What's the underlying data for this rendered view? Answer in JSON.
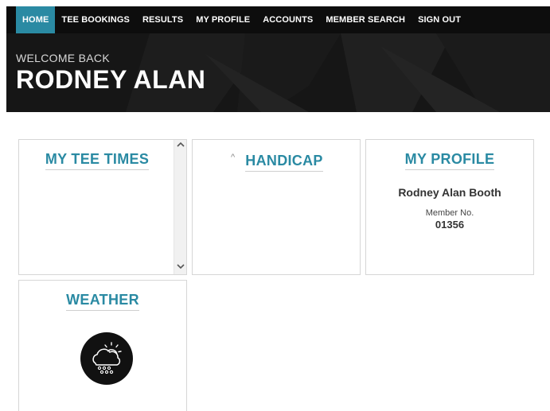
{
  "nav": {
    "items": [
      {
        "label": "HOME",
        "active": true
      },
      {
        "label": "TEE BOOKINGS",
        "active": false
      },
      {
        "label": "RESULTS",
        "active": false
      },
      {
        "label": "MY PROFILE",
        "active": false
      },
      {
        "label": "ACCOUNTS",
        "active": false
      },
      {
        "label": "MEMBER SEARCH",
        "active": false
      },
      {
        "label": "SIGN OUT",
        "active": false
      }
    ]
  },
  "welcome": {
    "greeting": "WELCOME BACK",
    "name": "RODNEY ALAN"
  },
  "tee_times": {
    "title": "MY TEE TIMES",
    "scroll_up_icon": "arrow-up-icon",
    "scroll_down_icon": "arrow-down-icon"
  },
  "handicap": {
    "title": "HANDICAP",
    "caret_icon": "caret-up-icon",
    "caret": "^"
  },
  "profile": {
    "title": "MY PROFILE",
    "full_name": "Rodney Alan Booth",
    "member_label": "Member No.",
    "member_number": "01356"
  },
  "weather": {
    "title": "WEATHER",
    "icon": "cloud-sun-rain-icon"
  },
  "colors": {
    "accent": "#2a8aa3",
    "header_bg": "#161616",
    "nav_bg": "#0d0d0d"
  }
}
